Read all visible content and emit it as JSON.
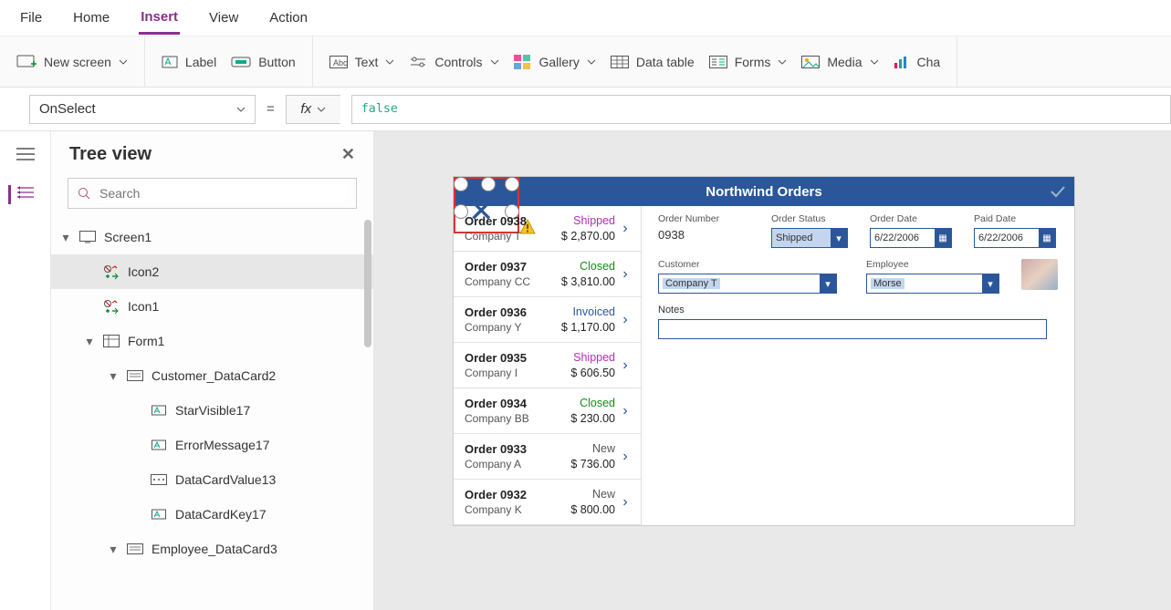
{
  "menubar": {
    "items": [
      "File",
      "Home",
      "Insert",
      "View",
      "Action"
    ],
    "active": 2
  },
  "ribbon": {
    "newscreen": "New screen",
    "label": "Label",
    "button": "Button",
    "text": "Text",
    "controls": "Controls",
    "gallery": "Gallery",
    "datatable": "Data table",
    "forms": "Forms",
    "media": "Media",
    "chart": "Cha"
  },
  "formulabar": {
    "property": "OnSelect",
    "fx": "fx",
    "expression": "false"
  },
  "treeview": {
    "title": "Tree view",
    "search_placeholder": "Search",
    "nodes": [
      {
        "depth": 0,
        "arrow": "▾",
        "icon": "screen",
        "label": "Screen1",
        "sel": false
      },
      {
        "depth": 1,
        "arrow": "",
        "icon": "iconctl",
        "label": "Icon2",
        "sel": true
      },
      {
        "depth": 1,
        "arrow": "",
        "icon": "iconctl",
        "label": "Icon1",
        "sel": false
      },
      {
        "depth": 1,
        "arrow": "▾",
        "icon": "form",
        "label": "Form1",
        "sel": false
      },
      {
        "depth": 2,
        "arrow": "▾",
        "icon": "card",
        "label": "Customer_DataCard2",
        "sel": false
      },
      {
        "depth": 3,
        "arrow": "",
        "icon": "field",
        "label": "StarVisible17",
        "sel": false
      },
      {
        "depth": 3,
        "arrow": "",
        "icon": "field",
        "label": "ErrorMessage17",
        "sel": false
      },
      {
        "depth": 3,
        "arrow": "",
        "icon": "combo",
        "label": "DataCardValue13",
        "sel": false
      },
      {
        "depth": 3,
        "arrow": "",
        "icon": "field",
        "label": "DataCardKey17",
        "sel": false
      },
      {
        "depth": 2,
        "arrow": "▾",
        "icon": "card",
        "label": "Employee_DataCard3",
        "sel": false
      }
    ]
  },
  "app": {
    "title": "Northwind Orders",
    "orders": [
      {
        "num": "Order 0938",
        "company": "Company T",
        "status": "Shipped",
        "amount": "$ 2,870.00"
      },
      {
        "num": "Order 0937",
        "company": "Company CC",
        "status": "Closed",
        "amount": "$ 3,810.00"
      },
      {
        "num": "Order 0936",
        "company": "Company Y",
        "status": "Invoiced",
        "amount": "$ 1,170.00"
      },
      {
        "num": "Order 0935",
        "company": "Company I",
        "status": "Shipped",
        "amount": "$ 606.50"
      },
      {
        "num": "Order 0934",
        "company": "Company BB",
        "status": "Closed",
        "amount": "$ 230.00"
      },
      {
        "num": "Order 0933",
        "company": "Company A",
        "status": "New",
        "amount": "$ 736.00"
      },
      {
        "num": "Order 0932",
        "company": "Company K",
        "status": "New",
        "amount": "$ 800.00"
      }
    ],
    "detail": {
      "order_number_lbl": "Order Number",
      "order_number": "0938",
      "order_status_lbl": "Order Status",
      "order_status": "Shipped",
      "order_date_lbl": "Order Date",
      "order_date": "6/22/2006",
      "paid_date_lbl": "Paid Date",
      "paid_date": "6/22/2006",
      "customer_lbl": "Customer",
      "customer": "Company T",
      "employee_lbl": "Employee",
      "employee": "Morse",
      "notes_lbl": "Notes"
    }
  }
}
